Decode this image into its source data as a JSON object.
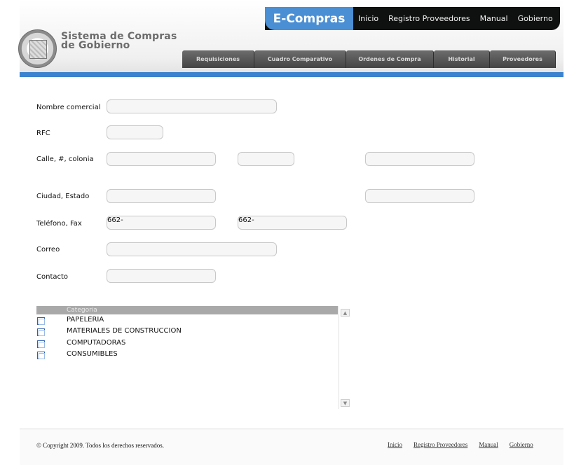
{
  "header": {
    "brand_line1": "Sistema de Compras",
    "brand_line2": "de Gobierno",
    "app_name": "E-Compras",
    "top_nav": [
      "Inicio",
      "Registro Proveedores",
      "Manual",
      "Gobierno"
    ],
    "tabs": [
      "Requisiciones",
      "Cuadro Comparativo",
      "Ordenes de Compra",
      "Historial",
      "Proveedores"
    ]
  },
  "form": {
    "labels": {
      "nombre": "Nombre comercial",
      "rfc": "RFC",
      "calle": "Calle, #, colonia",
      "ciudad": "Ciudad, Estado",
      "telefono": "Teléfono, Fax",
      "correo": "Correo",
      "contacto": "Contacto"
    },
    "values": {
      "telefono": "662-",
      "fax": "662-"
    }
  },
  "categories": {
    "header": "Categoria",
    "items": [
      "PAPELERIA",
      "MATERIALES DE CONSTRUCCION",
      "COMPUTADORAS",
      "CONSUMIBLES"
    ]
  },
  "footer": {
    "copyright": "© Copyright 2009. Todos los derechos reservados.",
    "links": [
      "Inicio",
      "Registro Proveedores",
      "Manual",
      "Gobierno"
    ]
  },
  "colors": {
    "accent": "#4a8fd4",
    "strip": "#3b83cf",
    "topbar": "#0f1010",
    "tab": "#555555"
  }
}
